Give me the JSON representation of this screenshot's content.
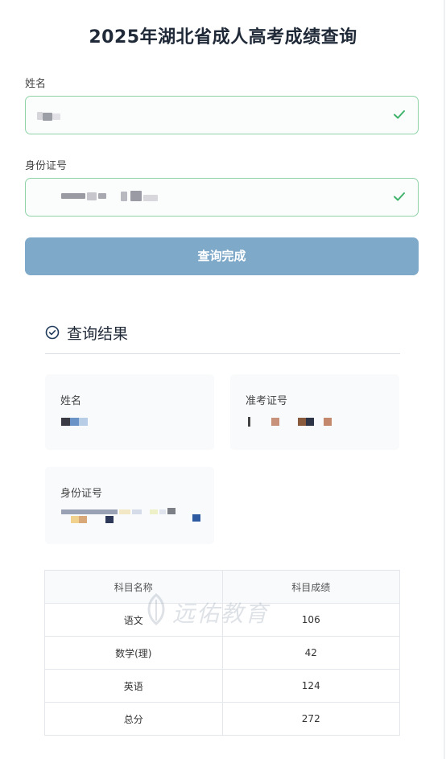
{
  "page": {
    "title": "2025年湖北省成人高考成绩查询"
  },
  "form": {
    "name_label": "姓名",
    "id_label": "身份证号",
    "submit_label": "查询完成",
    "accent_valid": "#8fd2a6",
    "button_color": "#7ea9c9"
  },
  "result": {
    "title": "查询结果",
    "name_label": "姓名",
    "ticket_label": "准考证号",
    "id_label": "身份证号"
  },
  "table": {
    "headers": [
      "科目名称",
      "科目成绩"
    ],
    "rows": [
      {
        "subject": "语文",
        "score": "106"
      },
      {
        "subject": "数学(理)",
        "score": "42"
      },
      {
        "subject": "英语",
        "score": "124"
      },
      {
        "subject": "总分",
        "score": "272"
      }
    ]
  },
  "watermark": {
    "text": "远佑教育"
  },
  "icons": {
    "valid": "check-icon",
    "result": "check-circle-icon",
    "watermark": "logo-leaf-icon"
  }
}
